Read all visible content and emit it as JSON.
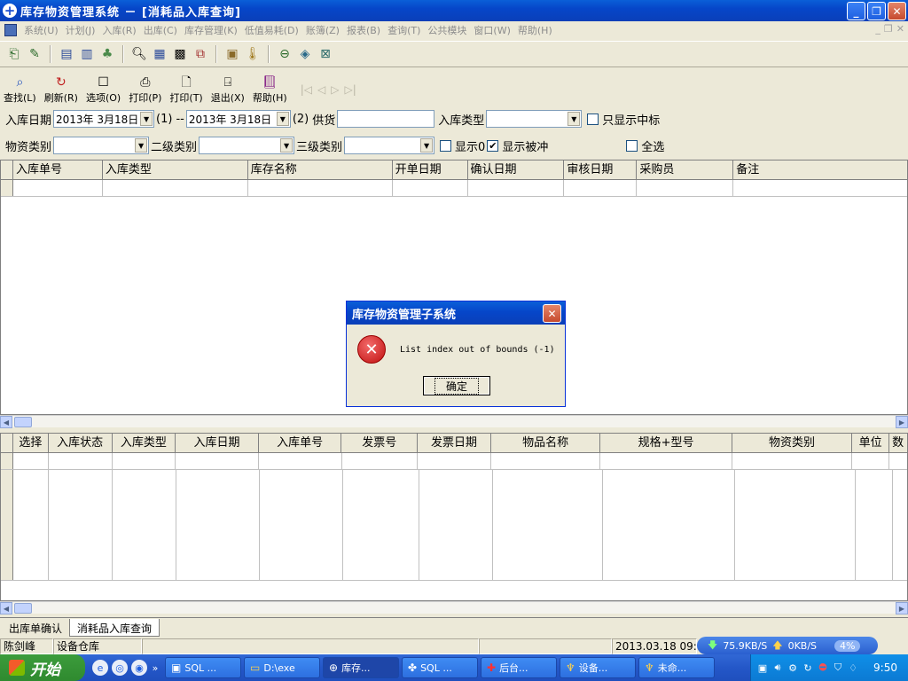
{
  "window": {
    "title": "库存物资管理系统 － [消耗品入库查询]"
  },
  "menu": [
    "系统(U)",
    "计划(J)",
    "入库(R)",
    "出库(C)",
    "库存管理(K)",
    "低值易耗(D)",
    "账簿(Z)",
    "报表(B)",
    "查询(T)",
    "公共模块",
    "窗口(W)",
    "帮助(H)"
  ],
  "toolbar2": [
    {
      "icon": "magnifier-icon",
      "label": "查找(L)"
    },
    {
      "icon": "refresh-icon",
      "label": "刷新(R)"
    },
    {
      "icon": "options-icon",
      "label": "选项(O)"
    },
    {
      "icon": "printer-icon",
      "label": "打印(P)"
    },
    {
      "icon": "print-preview-icon",
      "label": "打印(T)"
    },
    {
      "icon": "exit-door-icon",
      "label": "退出(X)"
    },
    {
      "icon": "help-book-icon",
      "label": "帮助(H)"
    }
  ],
  "filters": {
    "date_label": "入库日期",
    "date_from": "2013年  3月18日",
    "date_from_suffix": "(1)",
    "dash": "--",
    "date_to": "2013年  3月18日",
    "date_to_suffix": "(2)",
    "supplier_label": "供货",
    "supplier_value": "",
    "type_label": "入库类型",
    "type_value": "",
    "only_bid_label": "只显示中标",
    "category_label": "物资类别",
    "level2_label": "二级类别",
    "level3_label": "三级类别",
    "show0_label": "显示0",
    "show_offset_label": "显示被冲",
    "select_all_label": "全选"
  },
  "grid_top": {
    "columns": [
      "入库单号",
      "入库类型",
      "库存名称",
      "开单日期",
      "确认日期",
      "审核日期",
      "采购员",
      "备注"
    ]
  },
  "grid_bottom": {
    "columns": [
      "选择",
      "入库状态",
      "入库类型",
      "入库日期",
      "入库单号",
      "发票号",
      "发票日期",
      "物品名称",
      "规格+型号",
      "物资类别",
      "单位",
      "数"
    ]
  },
  "tabs": [
    "出库单确认",
    "消耗品入库查询"
  ],
  "status": {
    "user": "陈剑峰",
    "warehouse": "设备仓库",
    "datetime": "2013.03.18 09:47"
  },
  "netmon": {
    "down": "75.9KB/S",
    "up": "0KB/S",
    "cpu": "4%"
  },
  "dialog": {
    "title": "库存物资管理子系统",
    "message": "List index out of bounds (-1)",
    "ok": "确定"
  },
  "taskbar": {
    "start": "开始",
    "tasks": [
      {
        "icon": "sql-window-icon",
        "label": "SQL ..."
      },
      {
        "icon": "folder-icon",
        "label": "D:\\exe"
      },
      {
        "icon": "app-plus-icon",
        "label": "库存..."
      },
      {
        "icon": "sql-server-icon",
        "label": "SQL ..."
      },
      {
        "icon": "red-cross-icon",
        "label": "后台..."
      },
      {
        "icon": "equipment-icon",
        "label": "设备..."
      },
      {
        "icon": "equipment-icon",
        "label": "未命..."
      }
    ],
    "clock": "9:50"
  }
}
